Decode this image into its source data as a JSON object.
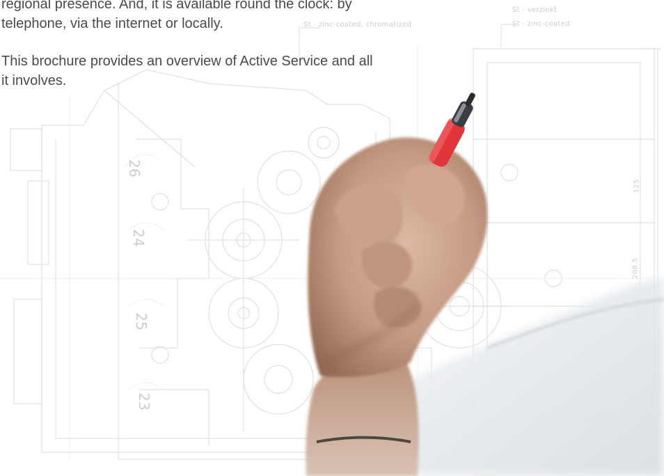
{
  "text": {
    "para1_line1": "regional presence. And, it is available round the clock: by",
    "para1_line2": "telephone, via the internet or locally.",
    "para2_line1": "This brochure provides an overview of Active Service and all",
    "para2_line2": "it involves."
  },
  "drawing_annotations": {
    "note_left": "St - zinc-coated, chromatized",
    "note_right_1": "St - verzinkt",
    "note_right_2": "St - zinc-coated",
    "dimension_1": "125",
    "dimension_2": "208.5",
    "marker_26": "26",
    "marker_24": "24",
    "marker_25": "25",
    "marker_23": "23"
  },
  "colors": {
    "body_text": "#4a4a4a",
    "drawing_lines": "#d9dde2",
    "pen_cap": "#e0363b",
    "skin": "#c79a82"
  }
}
